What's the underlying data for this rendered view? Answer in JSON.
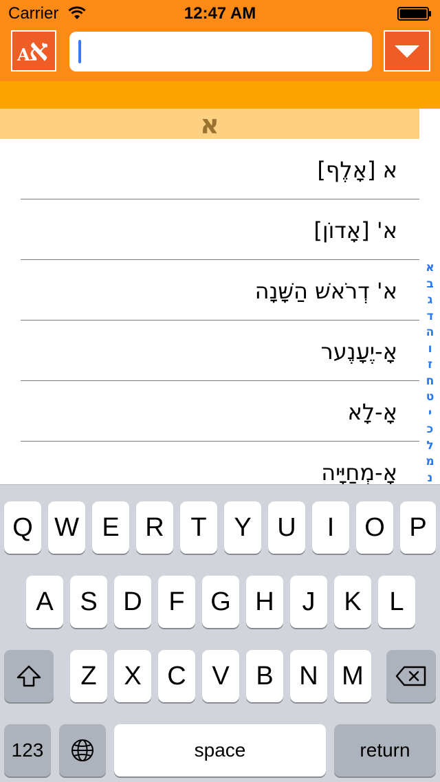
{
  "status": {
    "carrier": "Carrier",
    "time": "12:47 AM"
  },
  "header": {
    "lang_latin": "A",
    "lang_hebrew": "א",
    "search_value": "",
    "search_placeholder": ""
  },
  "section_title": "א",
  "entries": [
    "א [אָלֶף]",
    "א' [אָדוֹן]",
    "א' דְרֹאשׁ הַשָּׁנָה",
    "אָ-יֶעָנֶער",
    "אָ-לָא",
    "אָ-מְחַיָּיה"
  ],
  "index_letters": [
    "א",
    "ב",
    "ג",
    "ד",
    "ה",
    "ו",
    "ז",
    "ח",
    "ט",
    "י",
    "כ",
    "ל",
    "מ",
    "נ"
  ],
  "keyboard": {
    "row1": [
      "Q",
      "W",
      "E",
      "R",
      "T",
      "Y",
      "U",
      "I",
      "O",
      "P"
    ],
    "row2": [
      "A",
      "S",
      "D",
      "F",
      "G",
      "H",
      "J",
      "K",
      "L"
    ],
    "row3": [
      "Z",
      "X",
      "C",
      "V",
      "B",
      "N",
      "M"
    ],
    "numbers_label": "123",
    "space_label": "space",
    "return_label": "return"
  },
  "colors": {
    "header": "#fc8a17",
    "band": "#fea400",
    "section": "#fed182",
    "accent": "#ef5d27",
    "index": "#2878f0"
  }
}
